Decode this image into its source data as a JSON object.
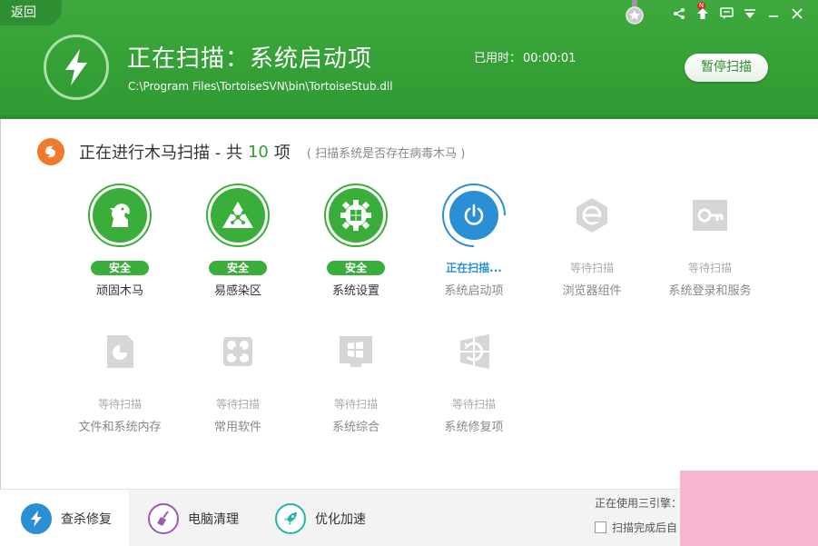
{
  "header": {
    "back_label": "返回",
    "title": "正在扫描：系统启动项",
    "path": "C:\\Program Files\\TortoiseSVN\\bin\\TortoiseStub.dll",
    "elapsed_label": "已用时：",
    "elapsed_value": "00:00:01",
    "pause_label": "暂停扫描",
    "progress_fraction": 0.05,
    "badge": "N",
    "accent_color": "#34a036"
  },
  "section": {
    "title": "正在进行木马扫描 - 共",
    "count": "10",
    "unit": "项",
    "subtitle": "( 扫描系统是否存在病毒木马 )"
  },
  "items": [
    {
      "label": "顽固木马",
      "status": "安全",
      "state": "safe",
      "icon": "horse-icon"
    },
    {
      "label": "易感染区",
      "status": "安全",
      "state": "safe",
      "icon": "network-warning-icon"
    },
    {
      "label": "系统设置",
      "status": "安全",
      "state": "safe",
      "icon": "windows-gear-icon"
    },
    {
      "label": "系统启动项",
      "status": "正在扫描...",
      "state": "scanning",
      "icon": "power-icon"
    },
    {
      "label": "浏览器组件",
      "status": "等待扫描",
      "state": "waiting",
      "icon": "browser-icon"
    },
    {
      "label": "系统登录和服务",
      "status": "等待扫描",
      "state": "waiting",
      "icon": "key-icon"
    },
    {
      "label": "文件和系统内存",
      "status": "等待扫描",
      "state": "waiting",
      "icon": "document-chart-icon"
    },
    {
      "label": "常用软件",
      "status": "等待扫描",
      "state": "waiting",
      "icon": "software-icon"
    },
    {
      "label": "系统综合",
      "status": "等待扫描",
      "state": "waiting",
      "icon": "windows-icon"
    },
    {
      "label": "系统修复项",
      "status": "等待扫描",
      "state": "waiting",
      "icon": "windows-repair-icon"
    }
  ],
  "footer": {
    "tabs": [
      {
        "label": "查杀修复",
        "icon": "lightning-icon",
        "color": "#2b8fd6"
      },
      {
        "label": "电脑清理",
        "icon": "broom-icon",
        "color": "#9b59b6"
      },
      {
        "label": "优化加速",
        "icon": "rocket-icon",
        "color": "#1fb5a6"
      }
    ],
    "engine_label": "正在使用三引擎：",
    "checkbox_label": "扫描完成后自"
  }
}
